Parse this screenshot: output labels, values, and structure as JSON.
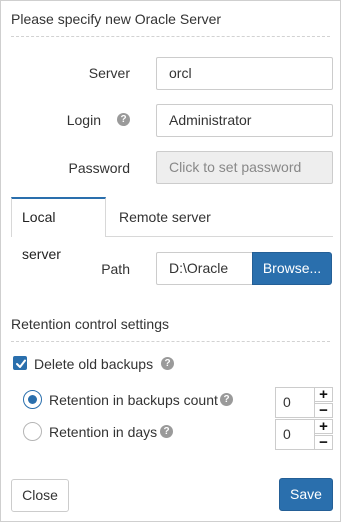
{
  "dialog": {
    "title": "Please specify new Oracle Server"
  },
  "form": {
    "server_label": "Server",
    "server_value": "orcl",
    "login_label": "Login",
    "login_value": "Administrator",
    "password_label": "Password",
    "password_placeholder": "Click to set password"
  },
  "tabs": [
    {
      "label": "Local server",
      "active": true
    },
    {
      "label": "Remote server",
      "active": false
    }
  ],
  "path": {
    "label": "Path",
    "value": "D:\\Oracle",
    "browse_label": "Browse..."
  },
  "retention": {
    "title": "Retention control settings",
    "delete_old_label": "Delete old backups",
    "delete_old_checked": true,
    "options": [
      {
        "label": "Retention in backups count",
        "selected": true,
        "value": "0"
      },
      {
        "label": "Retention in days",
        "selected": false,
        "value": "0"
      }
    ]
  },
  "footer": {
    "close_label": "Close",
    "save_label": "Save"
  },
  "icons": {
    "help": "question-circle-icon",
    "plus": "+",
    "minus": "−"
  },
  "colors": {
    "accent": "#2a6fad"
  }
}
